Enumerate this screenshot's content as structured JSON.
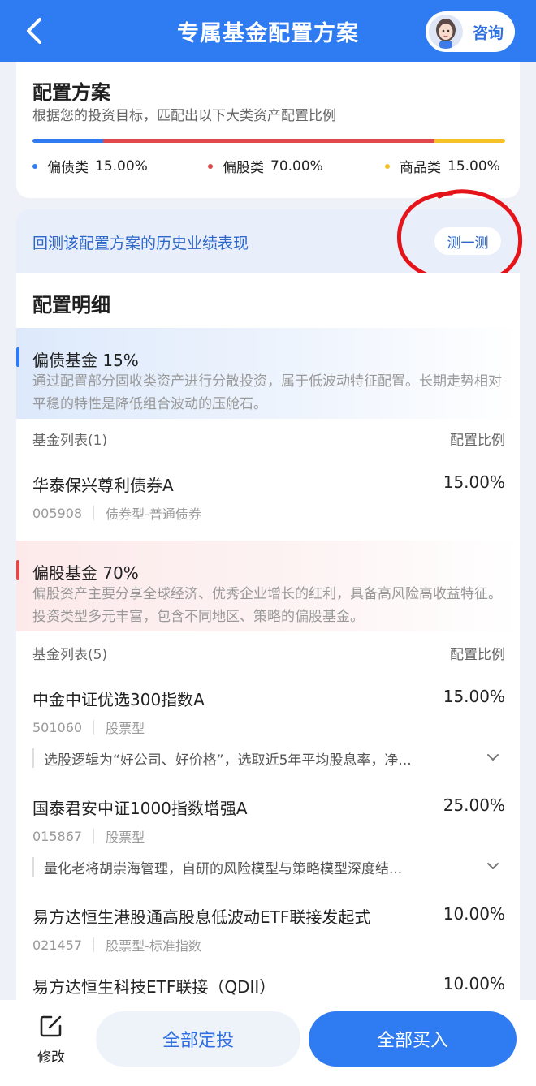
{
  "header": {
    "title": "专属基金配置方案",
    "consult_label": "咨询"
  },
  "plan": {
    "title": "配置方案",
    "subtitle": "根据您的投资目标，匹配出以下大类资产配置比例",
    "allocation": [
      {
        "label": "偏债类",
        "percent": "15.00%",
        "share": 0.15,
        "color": "#2f7bf1"
      },
      {
        "label": "偏股类",
        "percent": "70.00%",
        "share": 0.7,
        "color": "#e04a4a"
      },
      {
        "label": "商品类",
        "percent": "15.00%",
        "share": 0.15,
        "color": "#f5c22a"
      }
    ]
  },
  "backtest": {
    "text": "回测该配置方案的历史业绩表现",
    "button": "测一测"
  },
  "detail": {
    "title": "配置明细",
    "bond": {
      "title": "偏债基金 15%",
      "desc": "通过配置部分固收类资产进行分散投资，属于低波动特征配置。长期走势相对平稳的特性是降低组合波动的压舱石。",
      "list_label": "基金列表(1)",
      "ratio_label": "配置比例",
      "funds": [
        {
          "name": "华泰保兴尊利债券A",
          "ratio": "15.00%",
          "code": "005908",
          "type": "债券型-普通债券"
        }
      ]
    },
    "equity": {
      "title": "偏股基金 70%",
      "desc": "偏股资产主要分享全球经济、优秀企业增长的红利，具备高风险高收益特征。投资类型多元丰富，包含不同地区、策略的偏股基金。",
      "list_label": "基金列表(5)",
      "ratio_label": "配置比例",
      "funds": [
        {
          "name": "中金中证优选300指数A",
          "ratio": "15.00%",
          "code": "501060",
          "type": "股票型",
          "logic": "选股逻辑为“好公司、好价格”，选取近5年平均股息率，净..."
        },
        {
          "name": "国泰君安中证1000指数增强A",
          "ratio": "25.00%",
          "code": "015867",
          "type": "股票型",
          "logic": "量化老将胡崇海管理，自研的风险模型与策略模型深度结..."
        },
        {
          "name": "易方达恒生港股通高股息低波动ETF联接发起式",
          "ratio": "10.00%",
          "code": "021457",
          "type": "股票型-标准指数"
        },
        {
          "name": "易方达恒生科技ETF联接（QDII）",
          "ratio": "10.00%"
        }
      ]
    }
  },
  "bottom": {
    "edit_label": "修改",
    "plan_button": "全部定投",
    "buy_button": "全部买入"
  }
}
